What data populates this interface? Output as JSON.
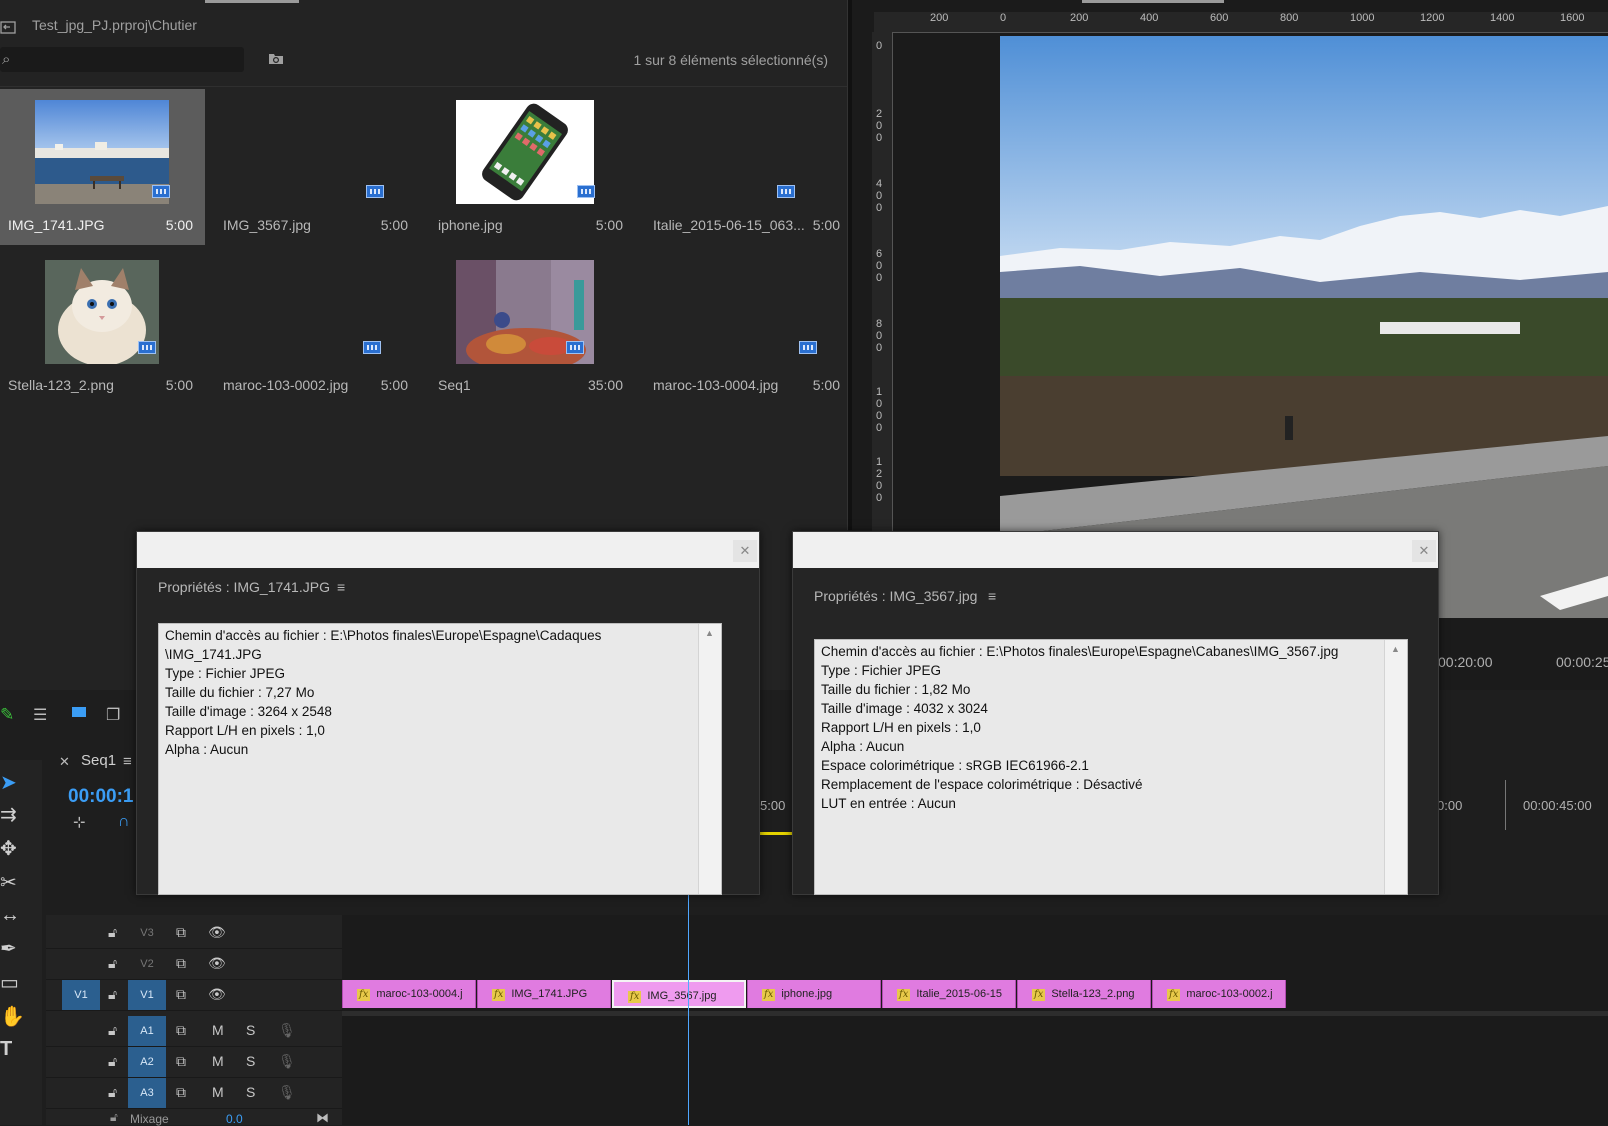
{
  "project": {
    "path": "Test_jpg_PJ.prproj\\Chutier",
    "selection_count": "1 sur 8 éléments sélectionné(s)",
    "search_placeholder": "",
    "items": [
      {
        "name": "IMG_1741.JPG",
        "duration": "5:00",
        "thumb": "harbor"
      },
      {
        "name": "IMG_3567.jpg",
        "duration": "5:00",
        "thumb": "none"
      },
      {
        "name": "iphone.jpg",
        "duration": "5:00",
        "thumb": "phone"
      },
      {
        "name": "Italie_2015-06-15_063...",
        "duration": "5:00",
        "thumb": "none"
      },
      {
        "name": "Stella-123_2.png",
        "duration": "5:00",
        "thumb": "cat"
      },
      {
        "name": "maroc-103-0002.jpg",
        "duration": "5:00",
        "thumb": "none"
      },
      {
        "name": "Seq1",
        "duration": "35:00",
        "thumb": "market"
      },
      {
        "name": "maroc-103-0004.jpg",
        "duration": "5:00",
        "thumb": "none"
      }
    ]
  },
  "monitor": {
    "ruler_top": [
      "200",
      "0",
      "200",
      "400",
      "600",
      "800",
      "1000",
      "1200",
      "1400",
      "1600"
    ],
    "ruler_left": [
      "0",
      "2 0 0",
      "4 0 0",
      "6 0 0",
      "8 0 0",
      "1 0 0 0",
      "1 2 0 0"
    ],
    "time_a": "00:20:00",
    "time_b": "00:00:25"
  },
  "timeline": {
    "sequence_tab": "Seq1",
    "timecode": "00:00:1",
    "ruler_labels": [
      "5:00",
      "0:00",
      "00:00:45:00"
    ],
    "mix_label": "Mixage",
    "mix_value": "0.0",
    "video_tracks": [
      {
        "name": "V3"
      },
      {
        "name": "V2"
      },
      {
        "name": "V1",
        "source": "V1"
      }
    ],
    "audio_tracks": [
      {
        "name": "A1",
        "m": "M",
        "s": "S"
      },
      {
        "name": "A2",
        "m": "M",
        "s": "S"
      },
      {
        "name": "A3",
        "m": "M",
        "s": "S"
      }
    ],
    "clips": [
      {
        "label": "maroc-103-0004.j",
        "fx": "fx"
      },
      {
        "label": "IMG_1741.JPG",
        "fx": "fx"
      },
      {
        "label": "IMG_3567.jpg",
        "fx": "fx",
        "selected": true
      },
      {
        "label": "iphone.jpg",
        "fx": "fx"
      },
      {
        "label": "Italie_2015-06-15",
        "fx": "fx"
      },
      {
        "label": "Stella-123_2.png",
        "fx": "fx"
      },
      {
        "label": "maroc-103-0002.j",
        "fx": "fx"
      }
    ]
  },
  "dialog1": {
    "title": "Propriétés : IMG_1741.JPG",
    "lines": [
      "Chemin d'accès au fichier : E:\\Photos finales\\Europe\\Espagne\\Cadaques",
      "\\IMG_1741.JPG",
      "Type : Fichier JPEG",
      "Taille du fichier : 7,27 Mo",
      "Taille d'image : 3264 x 2548",
      "Rapport L/H en pixels : 1,0",
      "Alpha : Aucun"
    ]
  },
  "dialog2": {
    "title": "Propriétés : IMG_3567.jpg",
    "lines": [
      "Chemin d'accès au fichier : E:\\Photos finales\\Europe\\Espagne\\Cabanes\\IMG_3567.jpg",
      "Type : Fichier JPEG",
      "Taille du fichier : 1,82 Mo",
      "Taille d'image : 4032 x 3024",
      "Rapport L/H en pixels : 1,0",
      "Alpha : Aucun",
      "Espace colorimétrique : sRGB IEC61966-2.1",
      "Remplacement de l'espace colorimétrique : Désactivé",
      "LUT en entrée : Aucun"
    ]
  },
  "colors": {
    "clip": "#e07be0",
    "accent": "#3b9df5",
    "target": "#2b5f8f",
    "badge": "#2a6fd0"
  }
}
